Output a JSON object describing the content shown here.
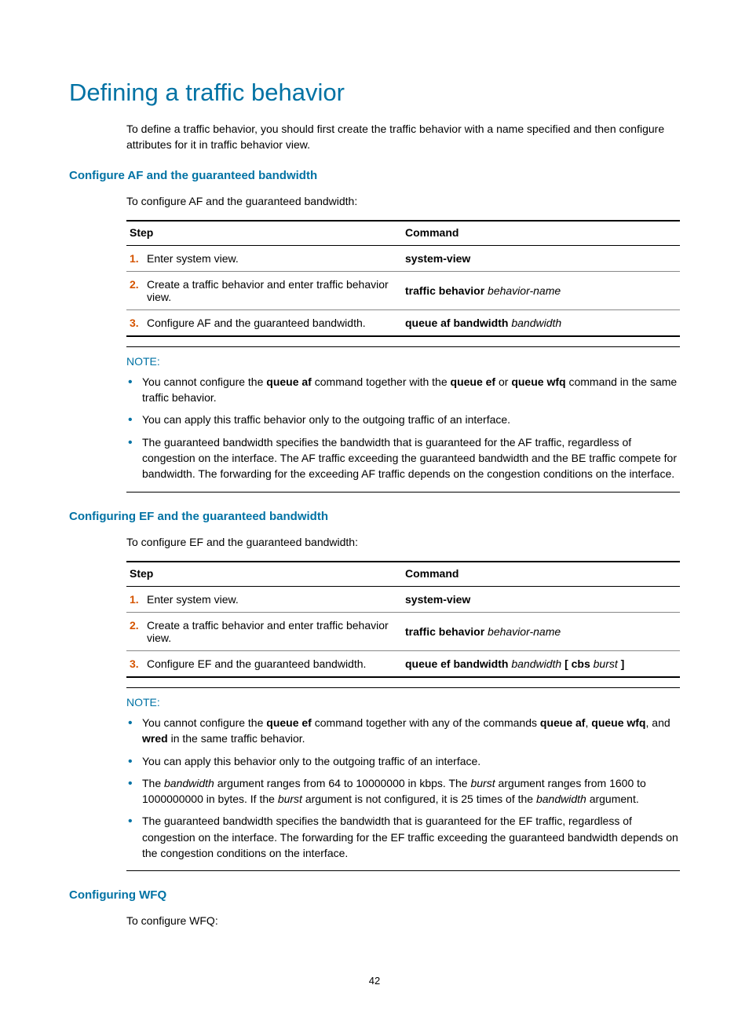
{
  "title": "Defining a traffic behavior",
  "intro": "To define a traffic behavior, you should first create the traffic behavior with a name specified and then configure attributes for it in traffic behavior view.",
  "section1": {
    "heading": "Configure AF and the guaranteed bandwidth",
    "lead": "To configure AF and the guaranteed bandwidth:",
    "th_step": "Step",
    "th_cmd": "Command",
    "rows": [
      {
        "n": "1.",
        "desc": "Enter system view.",
        "cmd_b": "system-view",
        "cmd_i": ""
      },
      {
        "n": "2.",
        "desc": "Create a traffic behavior and enter traffic behavior view.",
        "cmd_b": "traffic behavior",
        "cmd_i": " behavior-name"
      },
      {
        "n": "3.",
        "desc": "Configure AF and the guaranteed bandwidth.",
        "cmd_b": "queue af bandwidth",
        "cmd_i": " bandwidth"
      }
    ],
    "note_label": "NOTE:",
    "notes": {
      "n1_p1": "You cannot configure the ",
      "n1_b1": "queue af",
      "n1_p2": " command together with the ",
      "n1_b2": "queue ef",
      "n1_p3": " or ",
      "n1_b3": "queue wfq",
      "n1_p4": " command in the same traffic behavior.",
      "n2": "You can apply this traffic behavior only to the outgoing traffic of an interface.",
      "n3": "The guaranteed bandwidth specifies the bandwidth that is guaranteed for the AF traffic, regardless of congestion on the interface. The AF traffic exceeding the guaranteed bandwidth and the BE traffic compete for bandwidth. The forwarding for the exceeding AF traffic depends on the congestion conditions on the interface."
    }
  },
  "section2": {
    "heading": "Configuring EF and the guaranteed bandwidth",
    "lead": "To configure EF and the guaranteed bandwidth:",
    "th_step": "Step",
    "th_cmd": "Command",
    "rows": [
      {
        "n": "1.",
        "desc": "Enter system view.",
        "cmd_b": "system-view",
        "cmd_i": "",
        "cmd_b2": "",
        "cmd_i2": ""
      },
      {
        "n": "2.",
        "desc": "Create a traffic behavior and enter traffic behavior view.",
        "cmd_b": "traffic behavior",
        "cmd_i": " behavior-name",
        "cmd_b2": "",
        "cmd_i2": ""
      },
      {
        "n": "3.",
        "desc": "Configure EF and the guaranteed bandwidth.",
        "cmd_b": "queue ef bandwidth",
        "cmd_i": "  bandwidth ",
        "cmd_b2": "[ cbs",
        "cmd_i2": " burst ",
        "cmd_b3": "]"
      }
    ],
    "note_label": "NOTE:",
    "notes": {
      "n1_p1": "You cannot configure the ",
      "n1_b1": "queue ef",
      "n1_p2": " command together with any of the commands ",
      "n1_b2": "queue af",
      "n1_p3": ", ",
      "n1_b3": "queue wfq",
      "n1_p4": ", and ",
      "n1_b4": "wred",
      "n1_p5": " in the same traffic behavior.",
      "n2": "You can apply this behavior only to the outgoing traffic of an interface.",
      "n3_p1": "The ",
      "n3_i1": "bandwidth",
      "n3_p2": " argument ranges from 64 to 10000000 in kbps. The ",
      "n3_i2": "burst",
      "n3_p3": " argument ranges from 1600 to 1000000000 in bytes. If the ",
      "n3_i3": "burst",
      "n3_p4": " argument is not configured, it is 25 times of the ",
      "n3_i4": "bandwidth",
      "n3_p5": " argument.",
      "n4": "The guaranteed bandwidth specifies the bandwidth that is guaranteed for the EF traffic, regardless of congestion on the interface. The forwarding for the EF traffic exceeding the guaranteed bandwidth depends on the congestion conditions on the interface."
    }
  },
  "section3": {
    "heading": "Configuring WFQ",
    "lead": "To configure WFQ:"
  },
  "page_number": "42"
}
